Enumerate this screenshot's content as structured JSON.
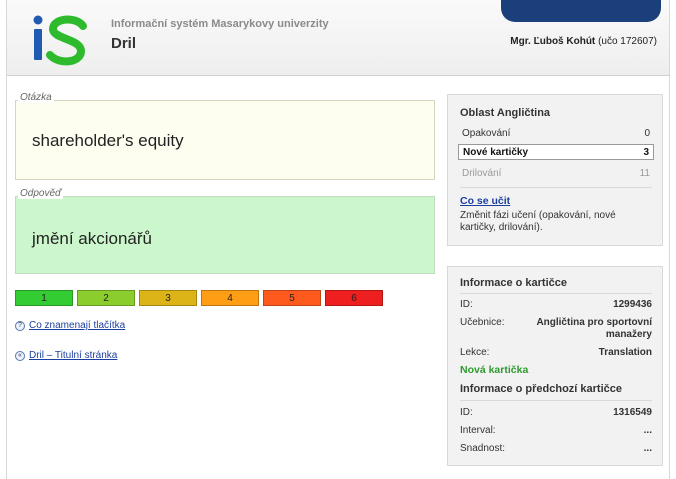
{
  "header": {
    "system_name": "Informační systém Masarykovy univerzity",
    "app_name": "Dril",
    "user_name": "Mgr. Ľuboš Kohút",
    "user_uco": "(učo 172607)"
  },
  "question": {
    "legend": "Otázka",
    "text": "shareholder's equity"
  },
  "answer": {
    "legend": "Odpověď",
    "text": "jmění akcionářů"
  },
  "grades": [
    "1",
    "2",
    "3",
    "4",
    "5",
    "6"
  ],
  "links": {
    "buttons_help": "Co znamenají tlačítka",
    "home": "Dril – Titulní stránka"
  },
  "area_panel": {
    "title": "Oblast Angličtina",
    "rows": [
      {
        "label": "Opakování",
        "value": "0"
      },
      {
        "label": "Nové kartičky",
        "value": "3"
      },
      {
        "label": "Drilování",
        "value": "11"
      }
    ],
    "learn_link": "Co se učit",
    "learn_desc": "Změnit fázi učení (opakování, nové kartičky, drilování)."
  },
  "card_info": {
    "title": "Informace o kartičce",
    "id_label": "ID:",
    "id_value": "1299436",
    "textbook_label": "Učebnice:",
    "textbook_value": "Angličtina pro sportovní manažery",
    "lesson_label": "Lekce:",
    "lesson_value": "Translation",
    "new_card": "Nová kartička",
    "prev_title": "Informace o předchozí kartičce",
    "prev_id_label": "ID:",
    "prev_id_value": "1316549",
    "interval_label": "Interval:",
    "interval_value": "...",
    "difficulty_label": "Snadnost:",
    "difficulty_value": "..."
  },
  "colors": {
    "brand_blue": "#1a3f7a",
    "question_bg": "#fefef0",
    "answer_bg": "#ccf7cc",
    "new_card_green": "#2e9a2e"
  }
}
